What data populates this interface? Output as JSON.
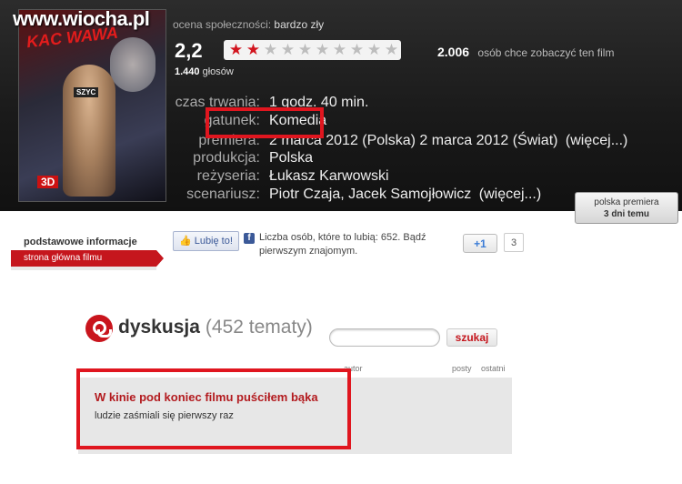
{
  "watermark": "www.wiocha.pl",
  "poster": {
    "title": "KAC WAWA",
    "labels": [
      "SZYC",
      "3D"
    ]
  },
  "rating": {
    "label": "ocena społeczności:",
    "value_text": "bardzo zły",
    "score": "2,2",
    "stars_filled": 2,
    "stars_total": 10,
    "votes_count": "1.440",
    "votes_label": "głosów"
  },
  "want": {
    "count": "2.006",
    "label": "osób chce zobaczyć ten film"
  },
  "details": {
    "duration_key": "czas trwania:",
    "duration_val": "1 godz. 40 min.",
    "genre_key": "gatunek:",
    "genre_val": "Komedia",
    "premiere_key": "premiera:",
    "premiere_val": "2 marca 2012 (Polska) 2 marca 2012 (Świat)",
    "premiere_more": "(więcej...)",
    "production_key": "produkcja:",
    "production_val": "Polska",
    "director_key": "reżyseria:",
    "director_val": "Łukasz Karwowski",
    "writer_key": "scenariusz:",
    "writer_val": "Piotr Czaja, Jacek Samojłowicz",
    "writer_more": "(więcej...)"
  },
  "premiere_badge": {
    "line1": "polska premiera",
    "line2": "3 dni temu"
  },
  "tabs": {
    "title": "podstawowe informacje",
    "active": "strona główna filmu"
  },
  "social": {
    "like_label": "Lubię to!",
    "like_text": "Liczba osób, które to lubią: 652. Bądź pierwszym znajomym.",
    "gplus_label": "+1",
    "gplus_count": "3"
  },
  "discussion": {
    "title_word": "dyskusja",
    "count": "(452 tematy)",
    "search_placeholder": "",
    "search_button": "szukaj",
    "col_author": "autor",
    "col_posts": "posty",
    "col_last": "ostatni",
    "thread_title": "W kinie pod koniec filmu puściłem bąka",
    "thread_sub": "ludzie zaśmiali się pierwszy raz"
  },
  "colors": {
    "accent": "#c5161d",
    "highlight": "#e0161f"
  }
}
